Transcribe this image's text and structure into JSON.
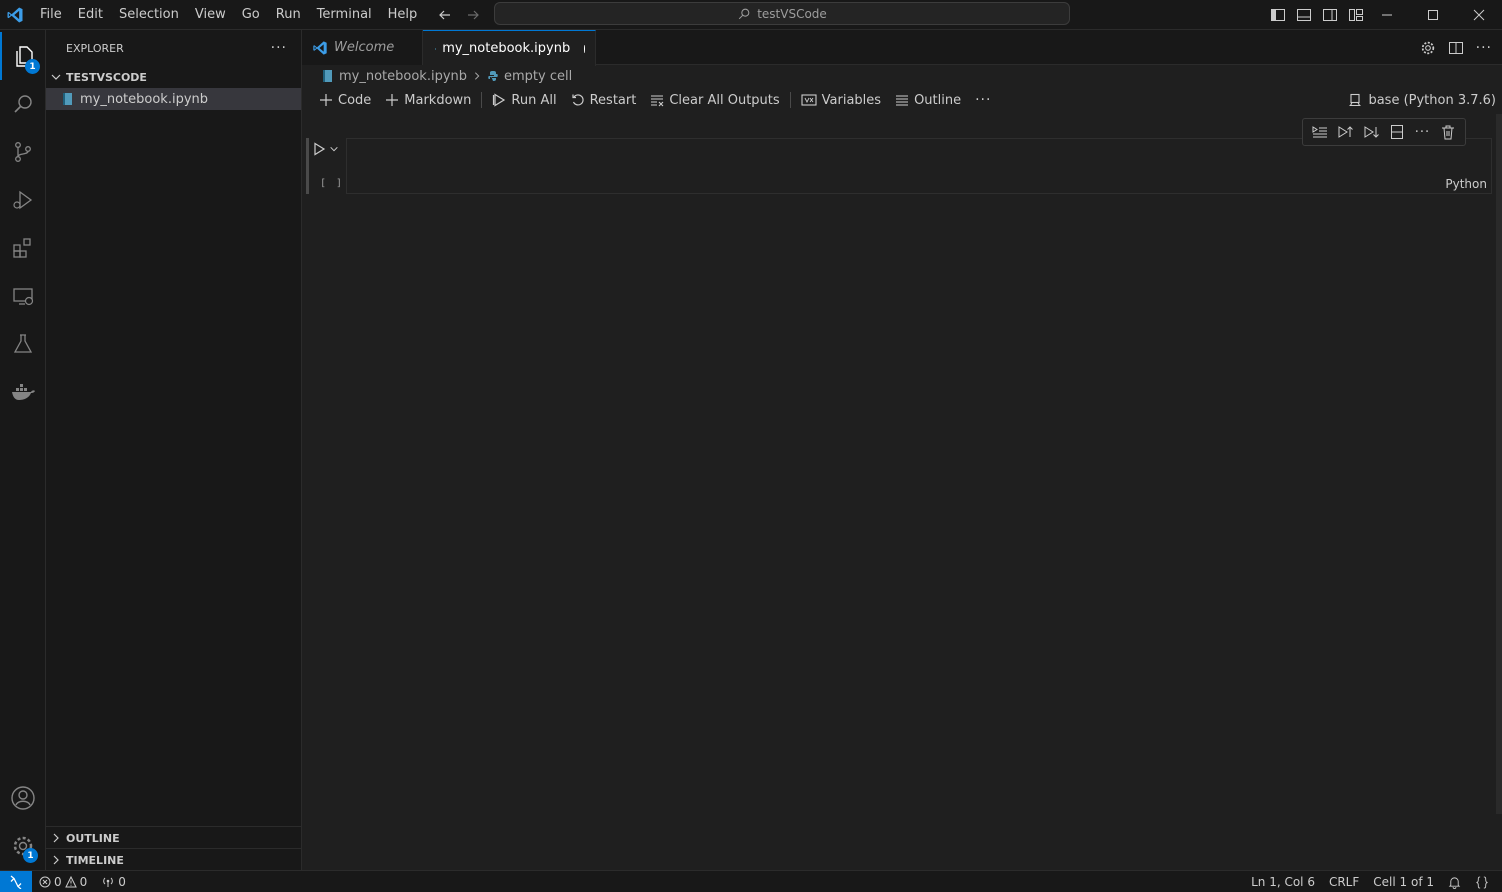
{
  "window": {
    "search_text": "testVSCode"
  },
  "menu": [
    "File",
    "Edit",
    "Selection",
    "View",
    "Go",
    "Run",
    "Terminal",
    "Help"
  ],
  "activity_bar": {
    "explorer_badge": "1",
    "settings_badge": "1"
  },
  "sidebar": {
    "title": "EXPLORER",
    "folder": "TESTVSCODE",
    "files": [
      "my_notebook.ipynb"
    ],
    "outline": "OUTLINE",
    "timeline": "TIMELINE"
  },
  "tabs": [
    {
      "label": "Welcome"
    },
    {
      "label": "my_notebook.ipynb"
    }
  ],
  "breadcrumb": {
    "file": "my_notebook.ipynb",
    "cell": "empty cell"
  },
  "toolbar": {
    "code": "Code",
    "markdown": "Markdown",
    "run_all": "Run All",
    "restart": "Restart",
    "clear_outputs": "Clear All Outputs",
    "variables": "Variables",
    "outline": "Outline",
    "kernel": "base (Python 3.7.6)"
  },
  "cell": {
    "exec_count": "[ ]",
    "language": "Python"
  },
  "status": {
    "errors": "0",
    "warnings": "0",
    "ports": "0",
    "position": "Ln 1, Col 6",
    "eol": "CRLF",
    "cell_pos": "Cell 1 of 1"
  },
  "colors": {
    "accent": "#0078d4",
    "background": "#1f1f1f",
    "sidebar": "#181818"
  }
}
